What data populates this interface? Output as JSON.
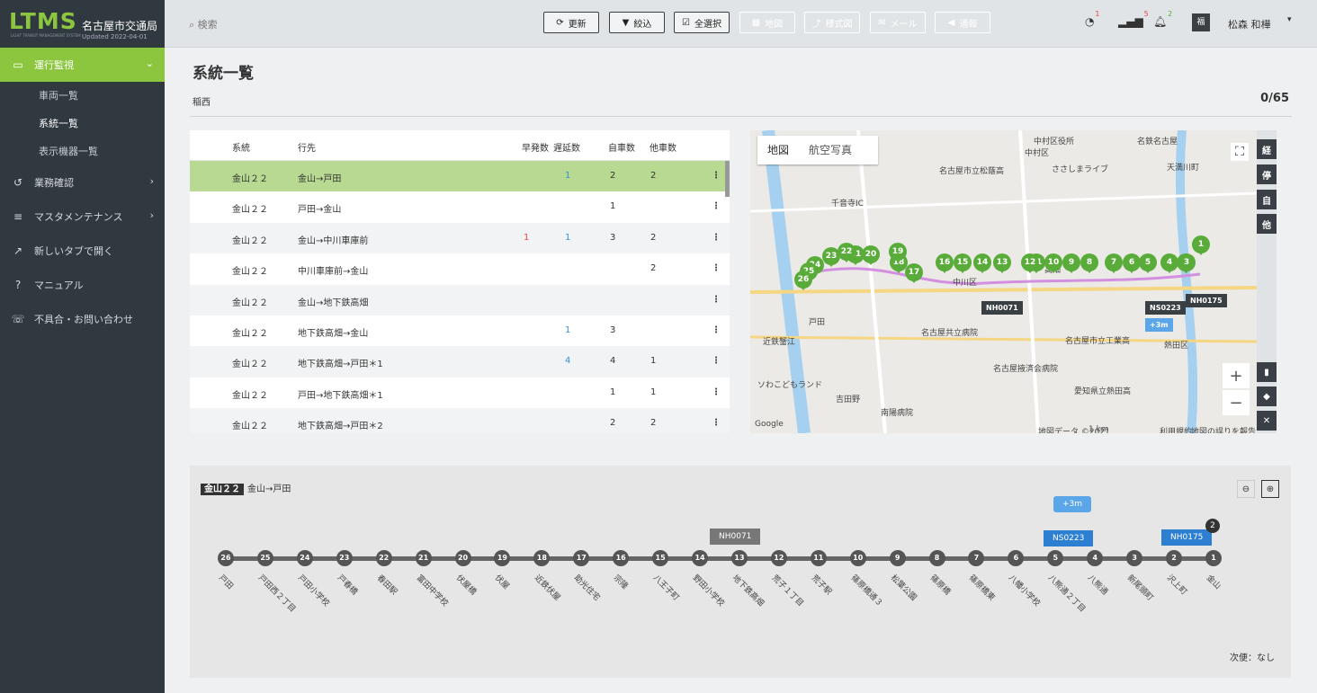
{
  "app": {
    "logo": "LTMS",
    "logo_sub": "LIGHT TRANSIT MANAGEMENT SYSTEM",
    "org": "名古屋市交通局",
    "updated": "Updated 2022-04-01"
  },
  "sidebar": {
    "active": "運行監視",
    "sub": [
      "車両一覧",
      "系統一覧",
      "表示機器一覧"
    ],
    "items": [
      "業務確認",
      "マスタメンテナンス",
      "新しいタブで開く",
      "マニュアル",
      "不具合・お問い合わせ"
    ]
  },
  "topbar": {
    "search_placeholder": "検索",
    "buttons": [
      "更新",
      "絞込",
      "全選択",
      "地図",
      "様式図",
      "メール",
      "通報"
    ],
    "badges": {
      "speed": "1",
      "signal": "5",
      "bell": "2"
    },
    "user": "松森 和樺"
  },
  "page": {
    "title": "系統一覧",
    "filter": "稲西",
    "count": "0/65"
  },
  "table": {
    "headers": [
      "系統",
      "行先",
      "早発数",
      "遅延数",
      "自車数",
      "他車数"
    ],
    "rows": [
      {
        "route": "金山２２",
        "dest": "金山→戸田",
        "early": "",
        "late": "1",
        "own": "2",
        "other": "2"
      },
      {
        "route": "金山２２",
        "dest": "戸田→金山",
        "early": "",
        "late": "",
        "own": "1",
        "other": ""
      },
      {
        "route": "金山２２",
        "dest": "金山→中川車庫前",
        "early": "1",
        "late": "1",
        "own": "3",
        "other": "2"
      },
      {
        "route": "金山２２",
        "dest": "中川車庫前→金山",
        "early": "",
        "late": "",
        "own": "",
        "other": "2"
      },
      {
        "route": "金山２２",
        "dest": "金山→地下鉄高畑",
        "early": "",
        "late": "",
        "own": "",
        "other": ""
      },
      {
        "route": "金山２２",
        "dest": "地下鉄高畑→金山",
        "early": "",
        "late": "1",
        "own": "3",
        "other": ""
      },
      {
        "route": "金山２２",
        "dest": "地下鉄高畑→戸田＊1",
        "early": "",
        "late": "4",
        "own": "4",
        "other": "1"
      },
      {
        "route": "金山２２",
        "dest": "戸田→地下鉄高畑＊1",
        "early": "",
        "late": "",
        "own": "1",
        "other": "1"
      },
      {
        "route": "金山２２",
        "dest": "地下鉄高畑→戸田＊2",
        "early": "",
        "late": "",
        "own": "2",
        "other": "2"
      }
    ]
  },
  "map": {
    "tabs": [
      "地図",
      "航空写真"
    ],
    "tools": [
      "経",
      "停",
      "自",
      "他"
    ],
    "labels": [
      "中村区",
      "中川区",
      "熱田区",
      "名古屋市立松蔭高",
      "名古屋共立病院",
      "名古屋掖済会病院",
      "愛知県立熱田高",
      "南陽病院",
      "名古屋市立工業高",
      "ささしまライブ",
      "天満川町",
      "中村区役所",
      "名鉄名古屋",
      "千音寺IC",
      "高畑",
      "戸田",
      "近鉄蟹江",
      "ソわこどもランド",
      "吉田野",
      "地図データ ©2021",
      "1 km",
      "利用規約",
      "地図の誤りを報告する",
      "Google"
    ],
    "pins": [
      "1",
      "2",
      "3",
      "4",
      "5",
      "6",
      "7",
      "8",
      "9",
      "10",
      "11",
      "12",
      "13",
      "14",
      "15",
      "16",
      "17",
      "18",
      "19",
      "20",
      "21",
      "22",
      "23",
      "24",
      "25",
      "26"
    ],
    "vehicles": [
      "NH0071",
      "NS0223",
      "NH0175"
    ],
    "delay": "+3m"
  },
  "route": {
    "tag": "金山２２",
    "dest": "金山→戸田",
    "next": "次便：なし",
    "delay": "+3m",
    "count": "2",
    "stops": [
      {
        "no": "26",
        "name": "戸田"
      },
      {
        "no": "25",
        "name": "戸田西２丁目"
      },
      {
        "no": "24",
        "name": "戸田小学校"
      },
      {
        "no": "23",
        "name": "戸春橋"
      },
      {
        "no": "22",
        "name": "春田駅"
      },
      {
        "no": "21",
        "name": "富田中学校"
      },
      {
        "no": "20",
        "name": "伏屋橋"
      },
      {
        "no": "19",
        "name": "伏屋"
      },
      {
        "no": "18",
        "name": "近鉄伏屋"
      },
      {
        "no": "17",
        "name": "助光住宅"
      },
      {
        "no": "16",
        "name": "宗隆"
      },
      {
        "no": "15",
        "name": "八王子町"
      },
      {
        "no": "14",
        "name": "野田小学校"
      },
      {
        "no": "13",
        "name": "地下鉄高畑"
      },
      {
        "no": "12",
        "name": "荒子１丁目"
      },
      {
        "no": "11",
        "name": "荒子駅"
      },
      {
        "no": "10",
        "name": "篠原橋通３"
      },
      {
        "no": "9",
        "name": "松葉公園"
      },
      {
        "no": "8",
        "name": "篠原橋"
      },
      {
        "no": "7",
        "name": "篠原橋東"
      },
      {
        "no": "6",
        "name": "八幡小学校"
      },
      {
        "no": "5",
        "name": "八熊通２丁目"
      },
      {
        "no": "4",
        "name": "八熊通"
      },
      {
        "no": "3",
        "name": "新尾頭町"
      },
      {
        "no": "2",
        "name": "沢上町"
      },
      {
        "no": "1",
        "name": "金山"
      }
    ]
  }
}
